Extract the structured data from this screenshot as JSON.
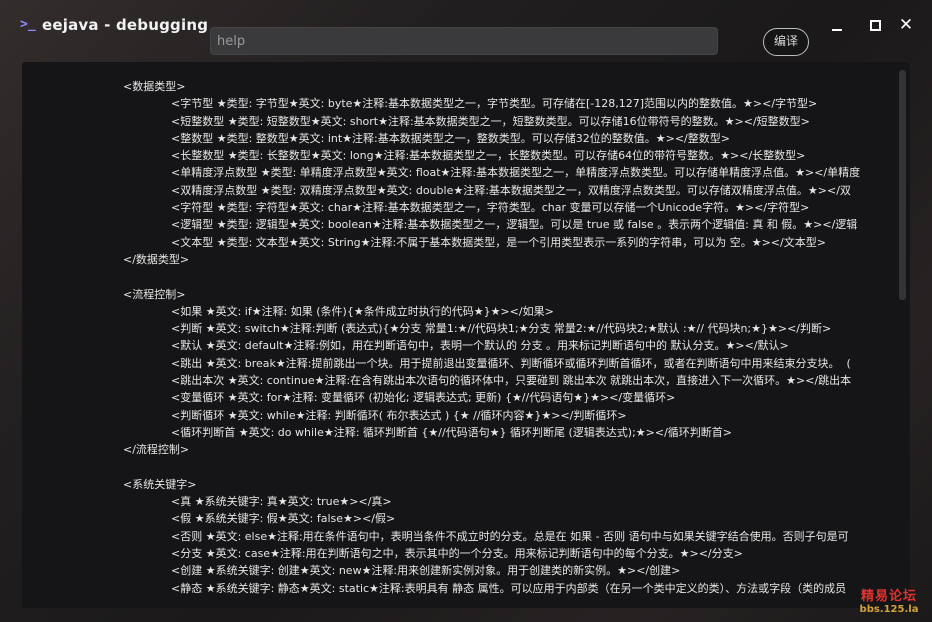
{
  "window": {
    "icon": "terminal-prompt-icon",
    "title": "eejava - debugging",
    "controls": {
      "minimize": "minimize-icon",
      "maximize": "maximize-icon",
      "close": "close-icon"
    },
    "close_glyph": "✕"
  },
  "toolbar": {
    "search_placeholder": "help",
    "compile_label": "编译"
  },
  "editor": {
    "lines": [
      {
        "indent": 0,
        "text": "<数据类型>"
      },
      {
        "indent": 1,
        "text": "<字节型 ★类型: 字节型★英文: byte★注释:基本数据类型之一，字节类型。可存储在[-128,127]范围以内的整数值。★></字节型>"
      },
      {
        "indent": 1,
        "text": "<短整数型 ★类型: 短整数型★英文: short★注释:基本数据类型之一，短整数类型。可以存储16位带符号的整数。★></短整数型>"
      },
      {
        "indent": 1,
        "text": "<整数型 ★类型: 整数型★英文: int★注释:基本数据类型之一，整数类型。可以存储32位的整数值。★></整数型>"
      },
      {
        "indent": 1,
        "text": "<长整数型 ★类型: 长整数型★英文: long★注释:基本数据类型之一，长整数类型。可以存储64位的带符号整数。★></长整数型>"
      },
      {
        "indent": 1,
        "text": "<单精度浮点数型 ★类型: 单精度浮点数型★英文: float★注释:基本数据类型之一，单精度浮点数类型。可以存储单精度浮点值。★></单精度"
      },
      {
        "indent": 1,
        "text": "<双精度浮点数型 ★类型: 双精度浮点数型★英文: double★注释:基本数据类型之一，双精度浮点数类型。可以存储双精度浮点值。★></双"
      },
      {
        "indent": 1,
        "text": "<字符型 ★类型: 字符型★英文: char★注释:基本数据类型之一，字符类型。char 变量可以存储一个Unicode字符。★></字符型>"
      },
      {
        "indent": 1,
        "text": "<逻辑型 ★类型: 逻辑型★英文: boolean★注释:基本数据类型之一，逻辑型。可以是 true 或 false 。表示两个逻辑值: 真 和 假。★></逻辑"
      },
      {
        "indent": 1,
        "text": "<文本型 ★类型: 文本型★英文: String★注释:不属于基本数据类型，是一个引用类型表示一系列的字符串，可以为 空。★></文本型>"
      },
      {
        "indent": 0,
        "text": "</数据类型>"
      },
      {
        "indent": 0,
        "text": ""
      },
      {
        "indent": 0,
        "text": "<流程控制>"
      },
      {
        "indent": 1,
        "text": "<如果 ★英文: if★注释: 如果 (条件){★条件成立时执行的代码★}★></如果>"
      },
      {
        "indent": 1,
        "text": "<判断 ★英文: switch★注释:判断 (表达式){★分支 常量1:★//代码块1;★分支 常量2:★//代码块2;★默认 :★// 代码块n;★}★></判断>"
      },
      {
        "indent": 1,
        "text": "<默认 ★英文: default★注释:例如，用在判断语句中，表明一个默认的 分支 。用来标记判断语句中的 默认分支。★></默认>"
      },
      {
        "indent": 1,
        "text": "<跳出 ★英文: break★注释:提前跳出一个块。用于提前退出变量循环、判断循环或循环判断首循环，或者在判断语句中用来结束分支块。  ("
      },
      {
        "indent": 1,
        "text": "<跳出本次 ★英文: continue★注释:在含有跳出本次语句的循环体中，只要碰到 跳出本次 就跳出本次，直接进入下一次循环。★></跳出本"
      },
      {
        "indent": 1,
        "text": "<变量循环 ★英文: for★注释: 变量循环 (初始化; 逻辑表达式; 更新) {★//代码语句★}★></变量循环>"
      },
      {
        "indent": 1,
        "text": "<判断循环 ★英文: while★注释: 判断循环( 布尔表达式 ) {★ //循环内容★}★></判断循环>"
      },
      {
        "indent": 1,
        "text": "<循环判断首 ★英文: do while★注释: 循环判断首 {★//代码语句★} 循环判断尾 (逻辑表达式);★></循环判断首>"
      },
      {
        "indent": 0,
        "text": "</流程控制>"
      },
      {
        "indent": 0,
        "text": ""
      },
      {
        "indent": 0,
        "text": "<系统关键字>"
      },
      {
        "indent": 1,
        "text": "<真 ★系统关键字: 真★英文: true★></真>"
      },
      {
        "indent": 1,
        "text": "<假 ★系统关键字: 假★英文: false★></假>"
      },
      {
        "indent": 1,
        "text": "<否则 ★英文: else★注释:用在条件语句中，表明当条件不成立时的分支。总是在 如果 - 否则 语句中与如果关键字结合使用。否则子句是可"
      },
      {
        "indent": 1,
        "text": "<分支 ★英文: case★注释:用在判断语句之中，表示其中的一个分支。用来标记判断语句中的每个分支。★></分支>"
      },
      {
        "indent": 1,
        "text": "<创建 ★系统关键字: 创建★英文: new★注释:用来创建新实例对象。用于创建类的新实例。★></创建>"
      },
      {
        "indent": 1,
        "text": "<静态 ★系统关键字: 静态★英文: static★注释:表明具有 静态 属性。可以应用于内部类（在另一个类中定义的类）、方法或字段（类的成员"
      }
    ]
  },
  "watermark": {
    "line1": "精易论坛",
    "line2": "bbs.125.la"
  }
}
